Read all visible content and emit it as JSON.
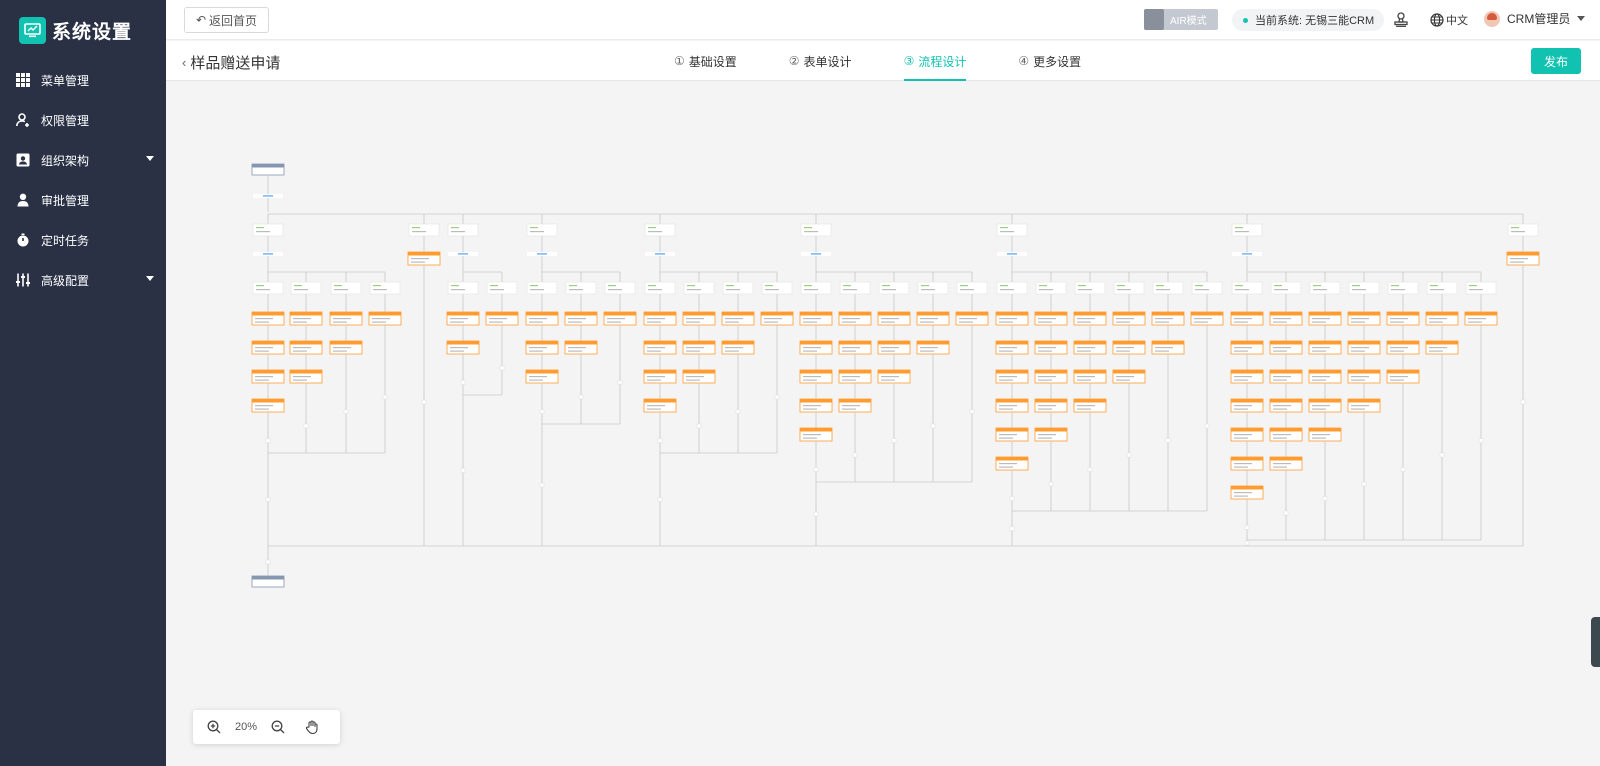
{
  "sidebar": {
    "title": "系统设置",
    "items": [
      {
        "label": "菜单管理",
        "icon": "grid-icon"
      },
      {
        "label": "权限管理",
        "icon": "user-key-icon"
      },
      {
        "label": "组织架构",
        "icon": "org-icon",
        "expandable": true
      },
      {
        "label": "审批管理",
        "icon": "approval-icon"
      },
      {
        "label": "定时任务",
        "icon": "timer-icon"
      },
      {
        "label": "高级配置",
        "icon": "sliders-icon",
        "expandable": true
      }
    ]
  },
  "header": {
    "back_label": "返回首页",
    "air_label": "AIR模式",
    "system_label": "当前系统: 无锡三能CRM",
    "lang_label": "中文",
    "user_label": "CRM管理员"
  },
  "subheader": {
    "page_title": "样品赠送申请",
    "steps": [
      {
        "num": "①",
        "label": "基础设置"
      },
      {
        "num": "②",
        "label": "表单设计"
      },
      {
        "num": "③",
        "label": "流程设计",
        "active": true
      },
      {
        "num": "④",
        "label": "更多设置"
      }
    ],
    "publish_label": "发布"
  },
  "zoom": {
    "value": "20%"
  },
  "colors": {
    "accent": "#11c2b0",
    "sidebar": "#2a3145",
    "node_orange": "#ff9b2f",
    "node_start": "#8796b0"
  }
}
